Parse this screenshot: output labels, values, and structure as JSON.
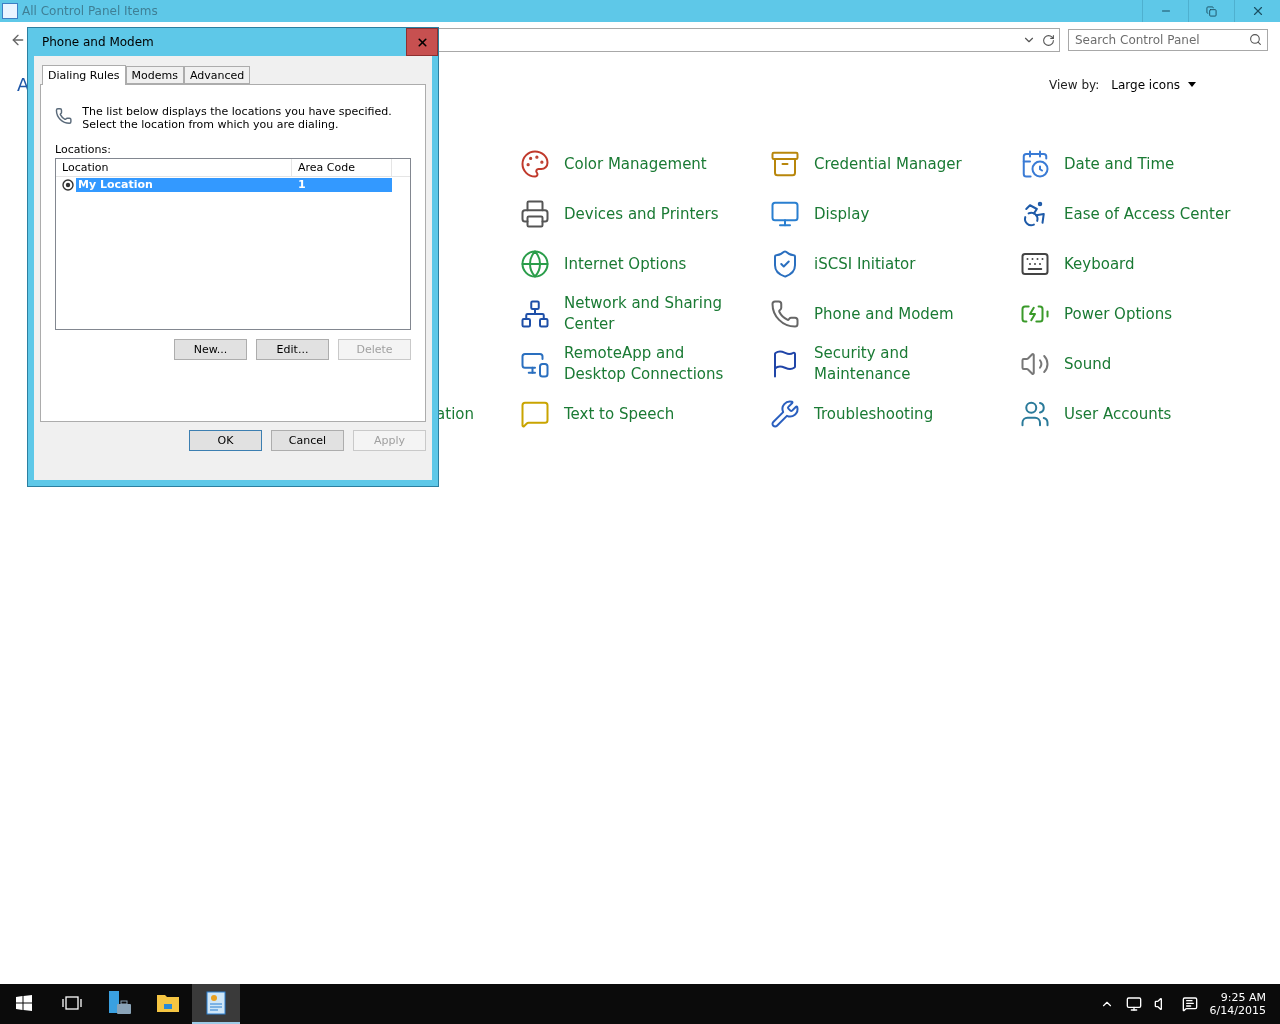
{
  "window": {
    "title": "All Control Panel Items",
    "active": false
  },
  "search": {
    "placeholder": "Search Control Panel"
  },
  "heading_fragment": "A",
  "view_by": {
    "label": "View by:",
    "value": "Large icons"
  },
  "partial_item": "ation",
  "items": [
    {
      "label": "Color Management"
    },
    {
      "label": "Credential Manager"
    },
    {
      "label": "Date and Time"
    },
    {
      "label": "Devices and Printers"
    },
    {
      "label": "Display"
    },
    {
      "label": "Ease of Access Center"
    },
    {
      "label": "Internet Options"
    },
    {
      "label": "iSCSI Initiator"
    },
    {
      "label": "Keyboard"
    },
    {
      "label": "Network and Sharing Center"
    },
    {
      "label": "Phone and Modem"
    },
    {
      "label": "Power Options"
    },
    {
      "label": "RemoteApp and Desktop Connections"
    },
    {
      "label": "Security and Maintenance"
    },
    {
      "label": "Sound"
    },
    {
      "label": "Text to Speech"
    },
    {
      "label": "Troubleshooting"
    },
    {
      "label": "User Accounts"
    }
  ],
  "dialog": {
    "title": "Phone and Modem",
    "tabs": [
      {
        "label": "Dialing Rules",
        "selected": true
      },
      {
        "label": "Modems",
        "selected": false
      },
      {
        "label": "Advanced",
        "selected": false
      }
    ],
    "description": "The list below displays the locations you have specified. Select the location from which you are dialing.",
    "list_label": "Locations:",
    "columns": [
      "Location",
      "Area Code"
    ],
    "rows": [
      {
        "location": "My Location",
        "area_code": "1",
        "selected": true,
        "default": true
      }
    ],
    "list_buttons": [
      {
        "label": "New...",
        "disabled": false
      },
      {
        "label": "Edit...",
        "disabled": false
      },
      {
        "label": "Delete",
        "disabled": true
      }
    ],
    "buttons": [
      {
        "label": "OK",
        "disabled": false,
        "default": true
      },
      {
        "label": "Cancel",
        "disabled": false,
        "default": false
      },
      {
        "label": "Apply",
        "disabled": true,
        "default": false
      }
    ]
  },
  "taskbar": {
    "apps": [
      {
        "kind": "start",
        "selected": false
      },
      {
        "kind": "taskview",
        "selected": false
      },
      {
        "kind": "server",
        "selected": false
      },
      {
        "kind": "folder",
        "selected": false
      },
      {
        "kind": "control",
        "selected": true
      }
    ],
    "time": "9:25 AM",
    "date": "6/14/2015"
  }
}
